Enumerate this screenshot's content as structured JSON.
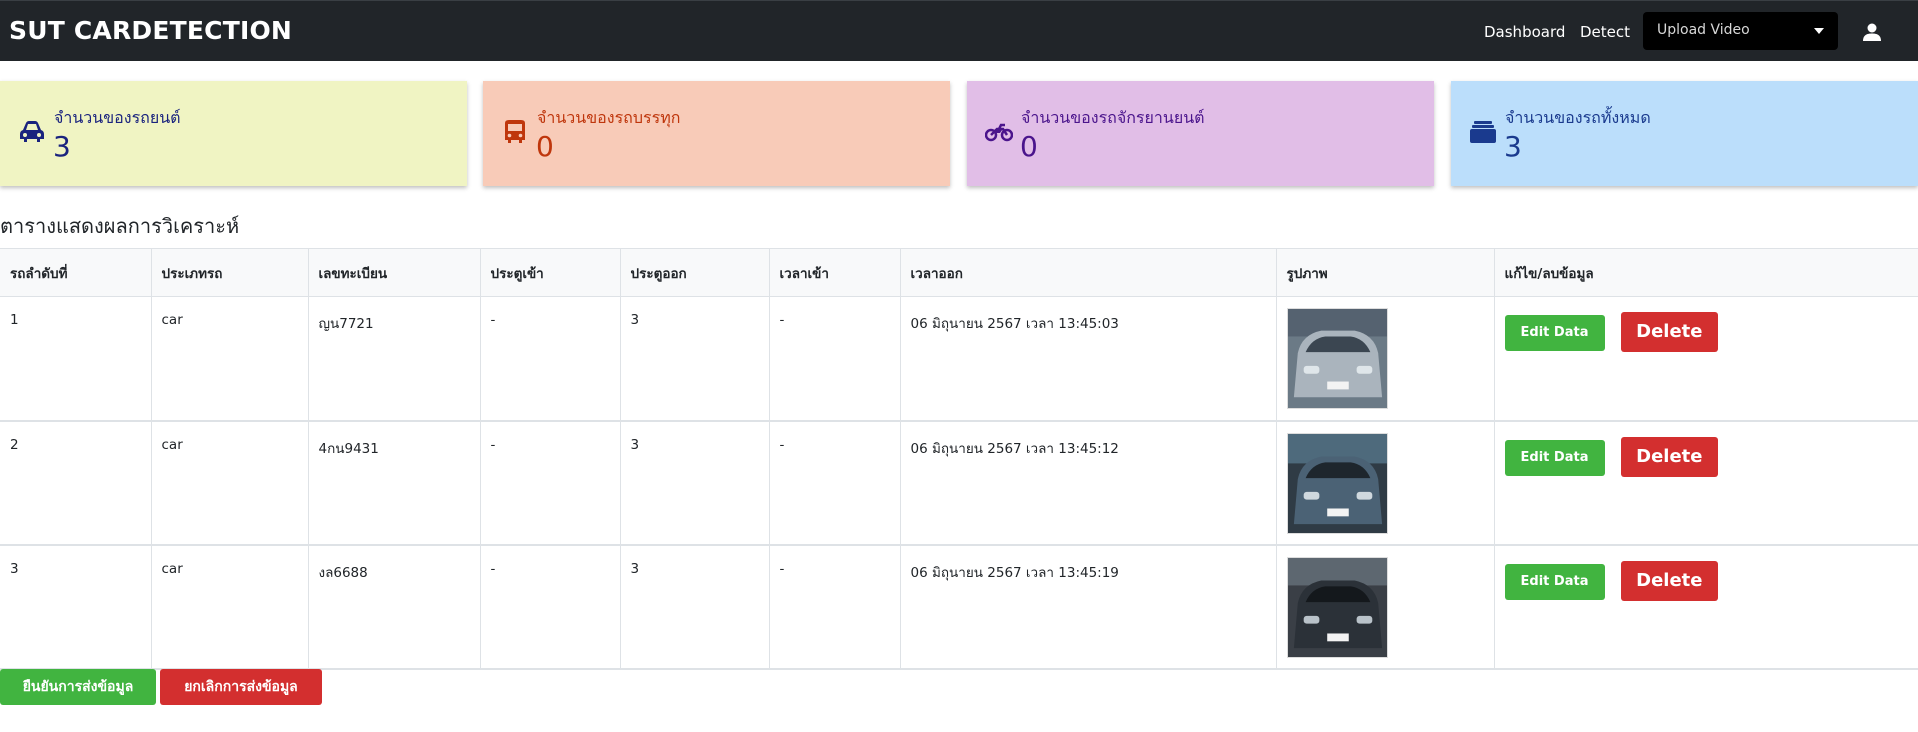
{
  "navbar": {
    "brand": "SUT CARDETECTION",
    "links": [
      "Dashboard",
      "Detect"
    ],
    "upload_select": "Upload Video"
  },
  "cards": [
    {
      "title": "จำนวนของรถยนต์",
      "value": "3",
      "icon": "car-icon",
      "bg": "#f0f4c3",
      "fg": "#1a237e"
    },
    {
      "title": "จำนวนของรถบรรทุก",
      "value": "0",
      "icon": "bus-icon",
      "bg": "#f8cbb8",
      "fg": "#bf360c"
    },
    {
      "title": "จำนวนของรถจักรยานยนต์",
      "value": "0",
      "icon": "motorcycle-icon",
      "bg": "#e1bee7",
      "fg": "#4a148c"
    },
    {
      "title": "จำนวนของรถทั้งหมด",
      "value": "3",
      "icon": "vehicle-stack-icon",
      "bg": "#bbdefb",
      "fg": "#1a3a8e"
    }
  ],
  "section_title": "ตารางแสดงผลการวิเคราะห์",
  "table": {
    "headers": [
      "รถลำดับที่",
      "ประเภทรถ",
      "เลขทะเบียน",
      "ประตูเข้า",
      "ประตูออก",
      "เวลาเข้า",
      "เวลาออก",
      "รูปภาพ",
      "แก้ไข/ลบข้อมูล"
    ],
    "rows": [
      {
        "no": "1",
        "type": "car",
        "plate": "ญน7721",
        "gate_in": "-",
        "gate_out": "3",
        "time_in": "-",
        "time_out": "06 มิถุนายน 2567 เวลา 13:45:03",
        "image_icon": "car-photo-1"
      },
      {
        "no": "2",
        "type": "car",
        "plate": "4กน9431",
        "gate_in": "-",
        "gate_out": "3",
        "time_in": "-",
        "time_out": "06 มิถุนายน 2567 เวลา 13:45:12",
        "image_icon": "car-photo-2"
      },
      {
        "no": "3",
        "type": "car",
        "plate": "งล6688",
        "gate_in": "-",
        "gate_out": "3",
        "time_in": "-",
        "time_out": "06 มิถุนายน 2567 เวลา 13:45:19",
        "image_icon": "car-photo-3"
      }
    ],
    "edit_label": "Edit Data",
    "delete_label": "Delete"
  },
  "footer": {
    "confirm_label": "ยืนยันการส่งข้อมูล",
    "cancel_label": "ยกเลิกการส่งข้อมูล"
  },
  "colors": {
    "navbar": "#212529",
    "success": "#41b440",
    "danger": "#d32f2f"
  }
}
